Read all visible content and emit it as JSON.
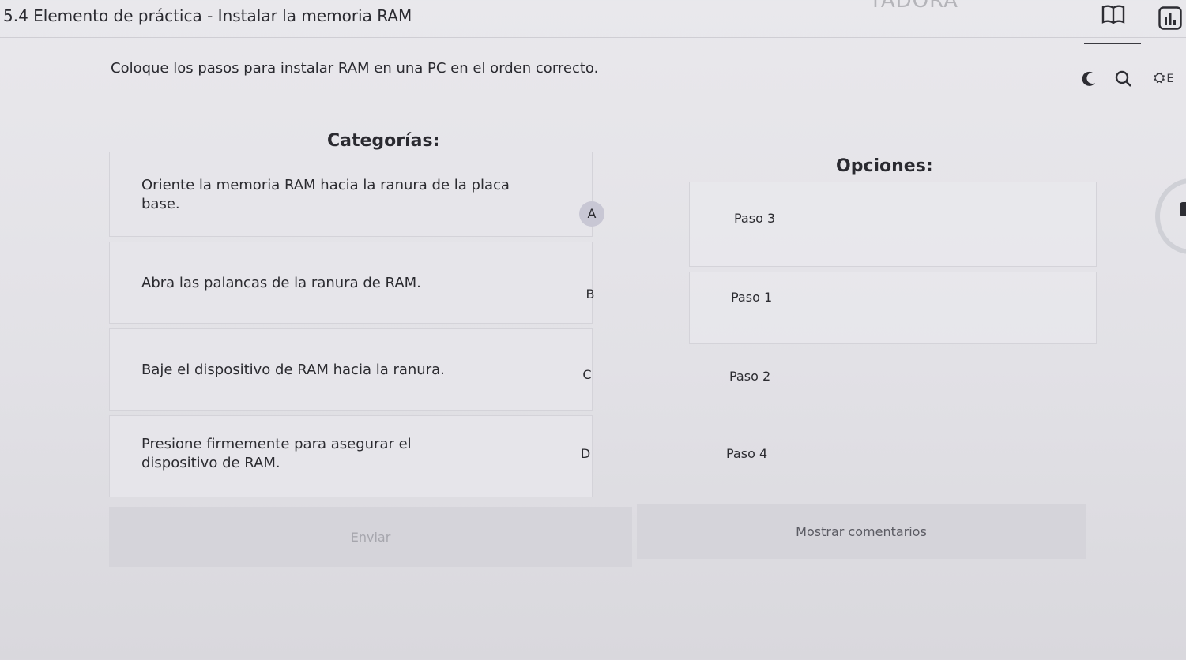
{
  "header": {
    "title": "5.4 Elemento de práctica - Instalar la memoria RAM",
    "faded_text": "TADORA"
  },
  "toolbar": {
    "book_icon": "book-icon",
    "chart_icon": "bar-chart-icon",
    "moon_icon": "moon-icon",
    "search_icon": "search-icon",
    "translate_icon": "translate-icon",
    "translate_label": "E"
  },
  "instructions": "Coloque los pasos para instalar RAM en una PC en el orden correcto.",
  "categories": {
    "heading": "Categorías:",
    "items": [
      {
        "text": "Oriente la memoria RAM hacia la ranura de la placa base.",
        "letter": "A"
      },
      {
        "text": "Abra las palancas de la ranura de RAM.",
        "letter": "B"
      },
      {
        "text": "Baje el dispositivo de RAM hacia la ranura.",
        "letter": "C"
      },
      {
        "text": "Presione firmemente para asegurar el dispositivo de RAM.",
        "letter": "D"
      }
    ]
  },
  "options": {
    "heading": "Opciones:",
    "items": [
      {
        "label": "Paso 3"
      },
      {
        "label": "Paso 1"
      },
      {
        "label": "Paso 2"
      },
      {
        "label": "Paso 4"
      }
    ]
  },
  "buttons": {
    "submit": "Enviar",
    "feedback": "Mostrar comentarios"
  },
  "colors": {
    "background": "#e6e5ea",
    "active_badge": "#c8c7d4",
    "disabled_text": "#a6a6ad"
  }
}
